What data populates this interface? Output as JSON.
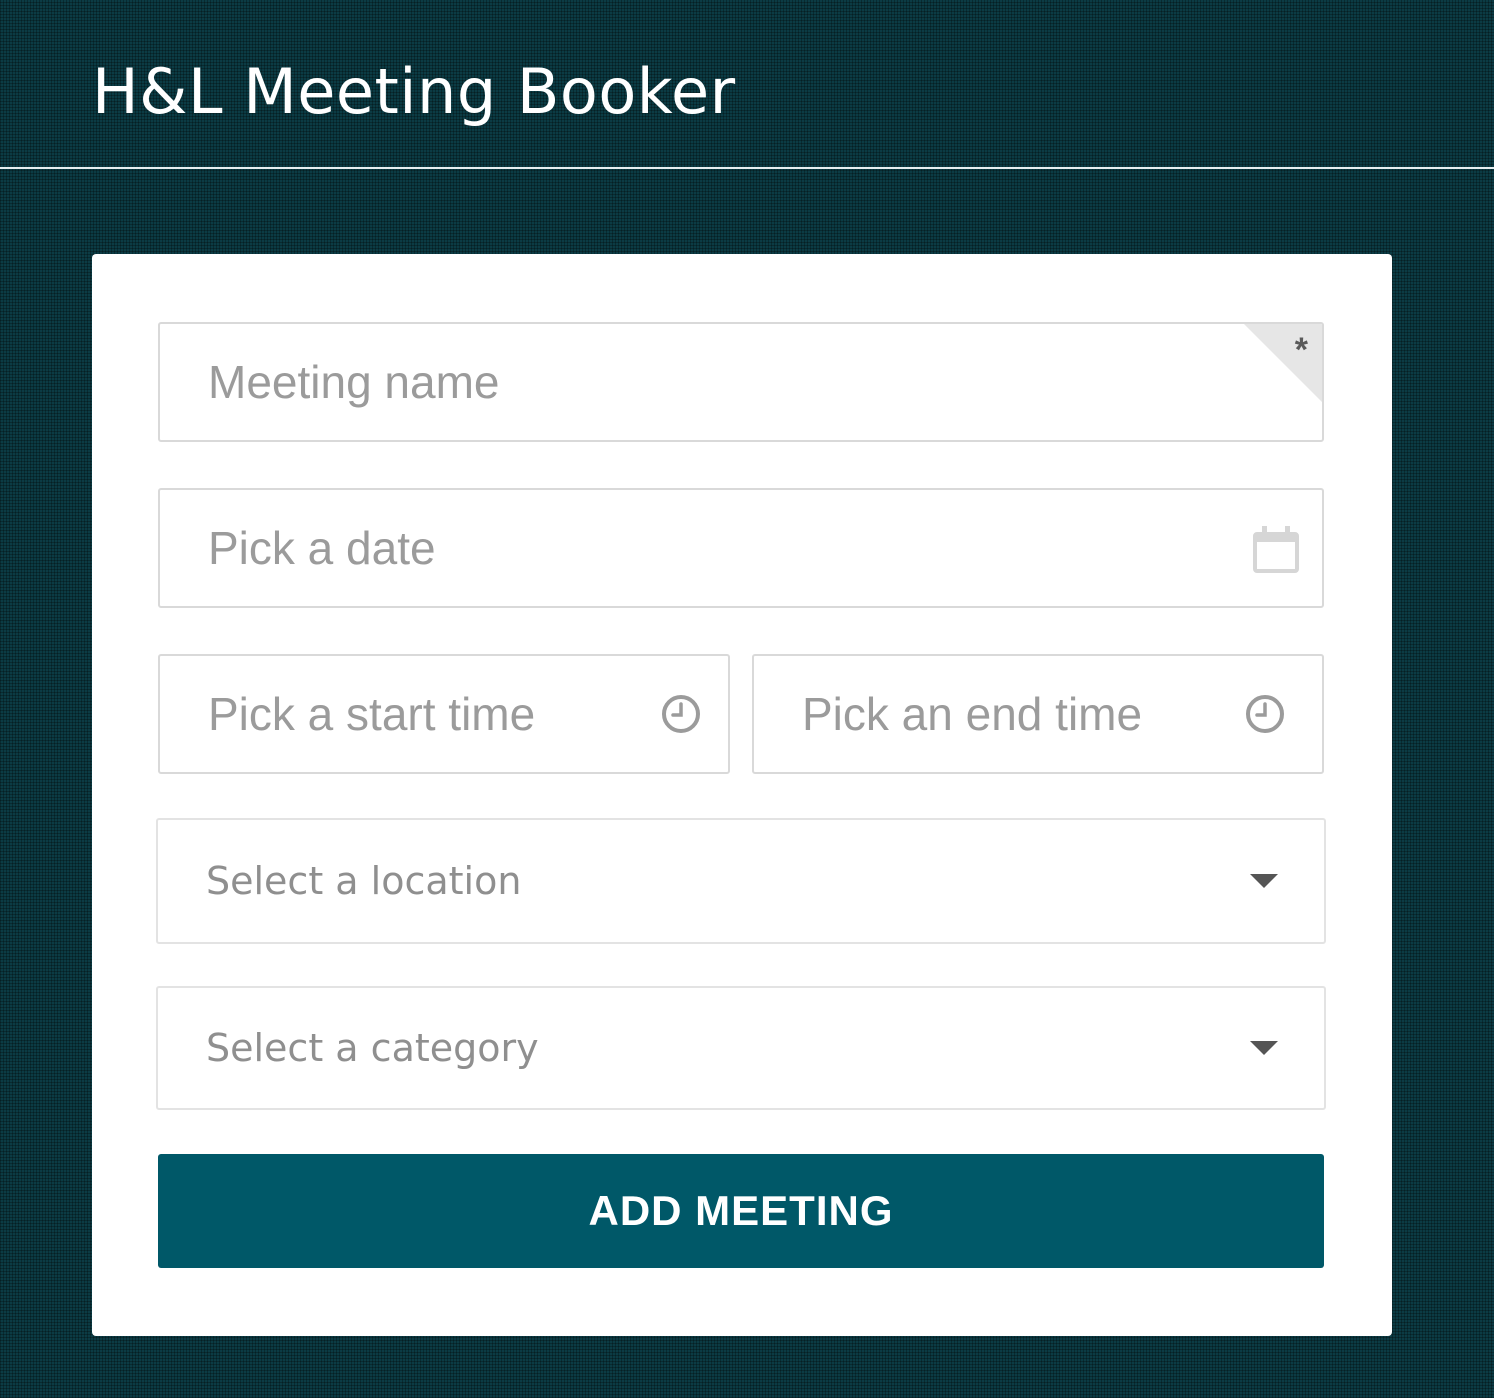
{
  "header": {
    "title": "H&L Meeting Booker"
  },
  "form": {
    "meeting_name": {
      "value": "",
      "placeholder": "Meeting name",
      "required_mark": "*"
    },
    "date": {
      "value": "",
      "placeholder": "Pick a date",
      "icon": "calendar-icon"
    },
    "start_time": {
      "value": "",
      "placeholder": "Pick a start time",
      "icon": "clock-icon"
    },
    "end_time": {
      "value": "",
      "placeholder": "Pick an end time",
      "icon": "clock-icon"
    },
    "location": {
      "selected": "Select a location",
      "icon": "chevron-down-icon"
    },
    "category": {
      "selected": "Select a category",
      "icon": "chevron-down-icon"
    },
    "submit_label": "ADD MEETING"
  },
  "colors": {
    "background": "#0b3b44",
    "card": "#ffffff",
    "button": "#005868",
    "placeholder": "#9b9b9b"
  }
}
